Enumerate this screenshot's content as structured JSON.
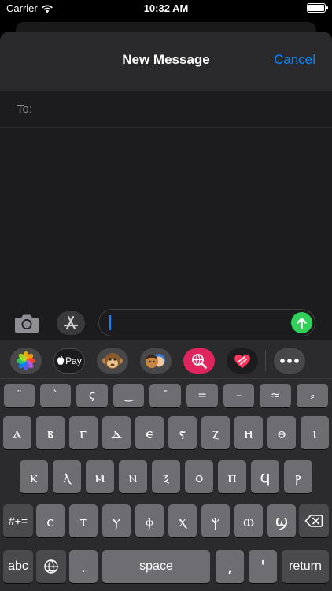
{
  "status": {
    "carrier": "Carrier",
    "time": "10:32 AM",
    "battery_level": 1.0
  },
  "nav": {
    "title": "New Message",
    "cancel": "Cancel"
  },
  "recipient": {
    "label": "To:",
    "value": ""
  },
  "compose": {
    "value": ""
  },
  "icons": {
    "wifi": "wifi-icon",
    "battery": "battery-icon",
    "camera": "camera-icon",
    "app_store": "app-store-icon",
    "send": "send-arrow-icon",
    "backspace": "backspace-icon",
    "globe": "globe-icon"
  },
  "apps": [
    {
      "name": "photos",
      "label": ""
    },
    {
      "name": "apple-pay",
      "label": "Pay"
    },
    {
      "name": "animoji",
      "label": ""
    },
    {
      "name": "memoji",
      "label": ""
    },
    {
      "name": "web-search",
      "label": ""
    },
    {
      "name": "digital-touch",
      "label": ""
    },
    {
      "name": "more",
      "label": ""
    }
  ],
  "keyboard": {
    "row0": [
      "¨",
      "`",
      "ϛ",
      "‿",
      "¯",
      "=",
      "–",
      "≈",
      "⸗"
    ],
    "row1": [
      "ⲁ",
      "ⲃ",
      "ⲅ",
      "ⲇ",
      "ⲉ",
      "ⲋ",
      "ⲍ",
      "ⲏ",
      "ⲑ",
      "ⲓ"
    ],
    "row2": [
      "ⲕ",
      "ⲗ",
      "ⲙ",
      "ⲛ",
      "ⲝ",
      "ⲟ",
      "ⲡ",
      "ϥ",
      "ⲣ"
    ],
    "row3": [
      "ⲥ",
      "ⲧ",
      "ⲩ",
      "ⲫ",
      "ⲭ",
      "ⲯ",
      "ⲱ",
      "ϣ"
    ],
    "shift_label": "#+=",
    "abc_label": "abc",
    "period": ".",
    "space_label": "space",
    "comma": ",",
    "apostrophe": "'",
    "return_label": "return"
  },
  "colors": {
    "accent": "#0a84ff",
    "send": "#30d158",
    "key": "#6e6e72",
    "key_dark": "#4a4a4d",
    "keyboard_bg": "#2b2b2d"
  }
}
